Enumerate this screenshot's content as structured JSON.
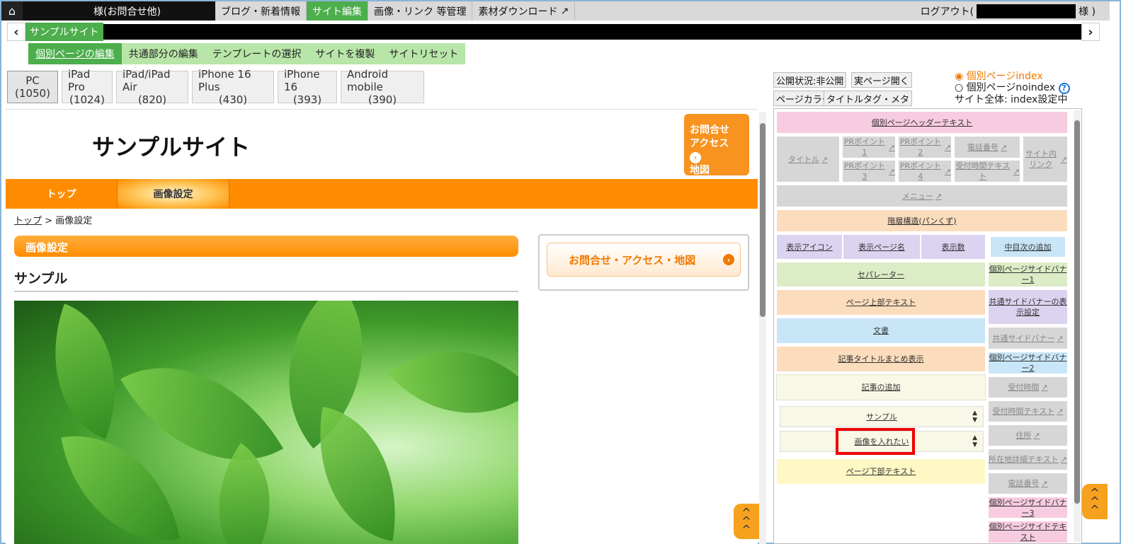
{
  "topbar": {
    "user_label": "様(お問合せ他)",
    "nav": [
      "ブログ・新着情報",
      "サイト編集",
      "画像・リンク 等管理",
      "素材ダウンロード"
    ],
    "active_index": 1,
    "logout_prefix": "ログアウト(",
    "logout_suffix": "様 )"
  },
  "site": {
    "name": "サンプルサイト"
  },
  "subnav": {
    "items": [
      "個別ページの編集",
      "共通部分の編集",
      "テンプレートの選択",
      "サイトを複製",
      "サイトリセット"
    ],
    "active_index": 0
  },
  "devices": [
    {
      "name": "PC",
      "width": "(1050)"
    },
    {
      "name": "iPad Pro",
      "width": "(1024)"
    },
    {
      "name": "iPad/iPad Air",
      "width": "(820)"
    },
    {
      "name": "iPhone 16 Plus",
      "width": "(430)"
    },
    {
      "name": "iPhone 16",
      "width": "(393)"
    },
    {
      "name": "Android mobile",
      "width": "(390)"
    }
  ],
  "preview": {
    "logo": "サンプルサイト",
    "cta_line1": "お問合せ",
    "cta_line2": "アクセス",
    "cta_line3": "地図",
    "gnav": [
      "トップ",
      "画像設定"
    ],
    "crumb_home": "トップ",
    "crumb_sep": " > ",
    "crumb_current": "画像設定",
    "h2": "画像設定",
    "h3": "サンプル",
    "side_cta": "お問合せ・アクセス・地図"
  },
  "controls": {
    "publish": "公開状況:非公開",
    "open_page": "実ページ開く",
    "page_color": "ページカラー",
    "title_tag": "タイトルタグ・メタ",
    "radio_index": "個別ページindex",
    "radio_noindex": "個別ページnoindex",
    "help": "?",
    "site_index": "サイト全体: index設定中"
  },
  "panel": {
    "header_text": "個別ページヘッダーテキスト",
    "title": "タイトル",
    "pr1": "PRポイント1",
    "pr2": "PRポイント2",
    "tel": "電話番号",
    "site_link": "サイト内リンク",
    "pr3": "PRポイント3",
    "pr4": "PRポイント4",
    "hours_text": "受付時間テキスト",
    "menu": "メニュー",
    "breadcrumb": "階層構造(パンくず)",
    "icon": "表示アイコン",
    "page_name": "表示ページ名",
    "count": "表示数",
    "add_toc": "中目次の追加",
    "separator": "セパレーター",
    "top_text": "ページ上部テキスト",
    "body_text": "文書",
    "summary": "記事タイトルまとめ表示",
    "add_article": "記事の追加",
    "article1": "サンプル",
    "article2": "画像を入れたい",
    "bottom_text": "ページ下部テキスト",
    "side_banner1": "個別ページサイドバナー1",
    "common_side_setting": "共通サイドバナーの表示設定",
    "common_side": "共通サイドバナー",
    "side_banner2": "個別ページサイドバナー2",
    "hours": "受付時間",
    "hours_text2": "受付時間テキスト",
    "address": "住所",
    "address_detail": "所在地詳細テキスト",
    "tel2": "電話番号",
    "side_banner3": "個別ページサイドバナー3",
    "side_text": "個別ページサイドテキスト"
  },
  "colors": {
    "green": "#4cae4c",
    "orange": "#ff8c00",
    "highlight": "#e00000"
  }
}
